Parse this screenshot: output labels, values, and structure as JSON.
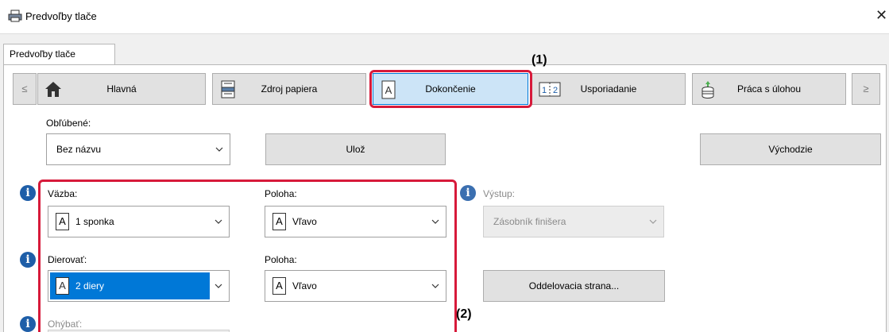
{
  "window": {
    "title": "Predvoľby tlače",
    "close_glyph": "✕"
  },
  "tabs": [
    {
      "label": "Predvoľby tlače"
    }
  ],
  "toolbar": {
    "prev_label": "≤",
    "next_label": "≥",
    "buttons": [
      {
        "label": "Hlavná",
        "icon": "home-icon",
        "active": false
      },
      {
        "label": "Zdroj papiera",
        "icon": "paper-tray-icon",
        "active": false
      },
      {
        "label": "Dokončenie",
        "icon": "finishing-doc-icon",
        "active": true
      },
      {
        "label": "Usporiadanie",
        "icon": "layout-1-2-icon",
        "active": false
      },
      {
        "label": "Práca s úlohou",
        "icon": "job-stack-icon",
        "active": false
      }
    ]
  },
  "favorites": {
    "label": "Obľúbené:",
    "value": "Bez názvu",
    "save_label": "Ulož",
    "defaults_label": "Východzie"
  },
  "binding": {
    "label": "Väzba:",
    "value": "1 sponka",
    "position_label": "Poloha:",
    "position_value": "Vľavo"
  },
  "punch": {
    "label": "Dierovať:",
    "value": "2 diery",
    "position_label": "Poloha:",
    "position_value": "Vľavo"
  },
  "output": {
    "label": "Výstup:",
    "value": "Zásobník finišera",
    "separator_label": "Oddelovacia strana..."
  },
  "fold": {
    "label": "Ohýbať:"
  },
  "callouts": {
    "one": "(1)",
    "two": "(2)"
  },
  "colors": {
    "accent": "#0078d7",
    "callout": "#d71a3a",
    "info": "#1e5ea8"
  }
}
